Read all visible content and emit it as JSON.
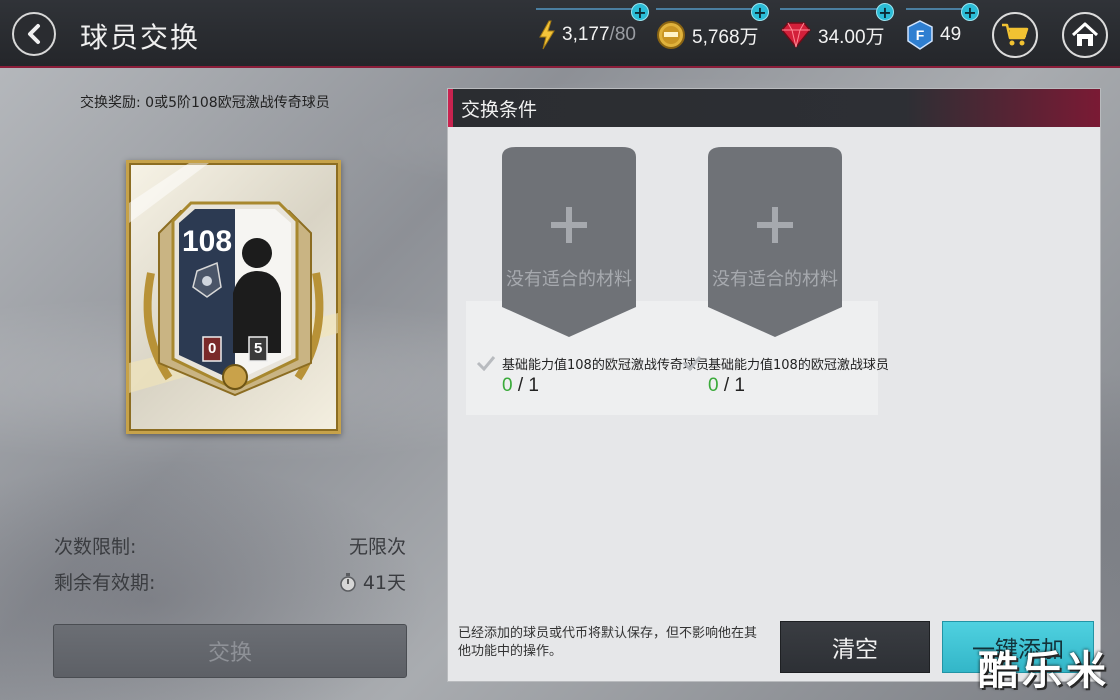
{
  "header": {
    "title": "球员交换",
    "stamina": "3,177",
    "stamina_max": "/80",
    "coins": "5,768万",
    "gems": "34.00万",
    "fifa_points": "49"
  },
  "reward": {
    "text": "交换奖励:   0或5阶108欧冠激战传奇球员",
    "card": {
      "rating": "108",
      "rank_left": "0",
      "rank_right": "5"
    }
  },
  "limits": {
    "count_label": "次数限制:",
    "count_value": "无限次",
    "expiry_label": "剩余有效期:",
    "expiry_value": "41天"
  },
  "exchange_button": "交换",
  "panel": {
    "title": "交换条件",
    "slots": [
      {
        "empty_text": "没有适合的材料",
        "requirement": "基础能力值108的欧冠激战传奇球员",
        "have": "0",
        "need": "/ 1"
      },
      {
        "empty_text": "没有适合的材料",
        "requirement": "基础能力值108的欧冠激战球员",
        "have": "0",
        "need": "/ 1"
      }
    ],
    "note": "已经添加的球员或代币将默认保存，但不影响他在其他功能中的操作。",
    "clear_button": "清空",
    "add_all_button": "一键添加"
  },
  "watermark": "酷乐米",
  "colors": {
    "accent_cyan": "#33b6c8",
    "accent_crimson": "#c8234f",
    "progress_green": "#3aaa3a"
  }
}
